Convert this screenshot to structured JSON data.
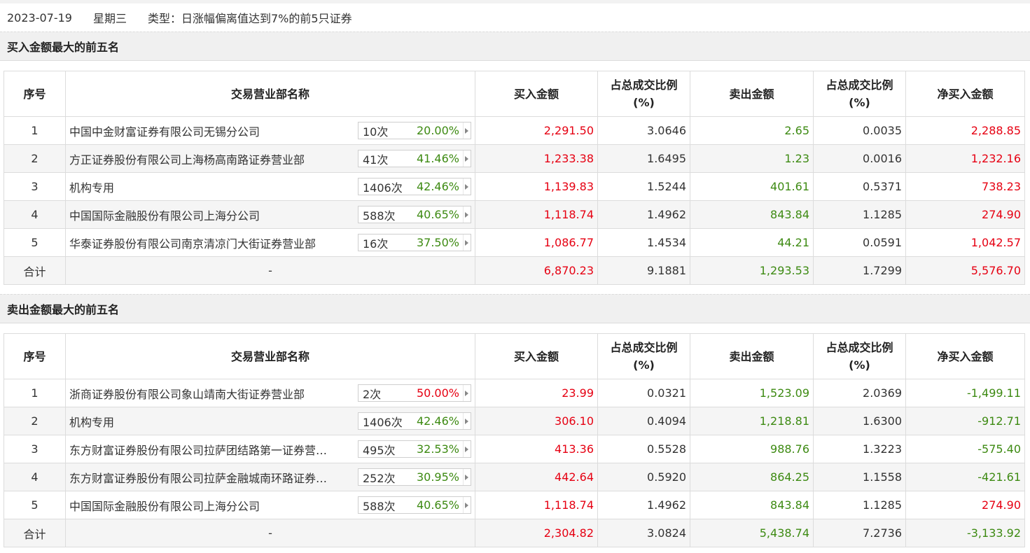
{
  "header": {
    "date": "2023-07-19",
    "weekday": "星期三",
    "type": "类型：日涨幅偏离值达到7%的前5只证券"
  },
  "columns": {
    "idx": "序号",
    "name": "交易营业部名称",
    "buy": "买入金额",
    "buy_pct_l1": "占总成交比例",
    "buy_pct_l2": "(%)",
    "sell": "卖出金额",
    "sell_pct_l1": "占总成交比例",
    "sell_pct_l2": "(%)",
    "net": "净买入金额"
  },
  "buy_section": {
    "title": "买入金额最大的前五名",
    "rows": [
      {
        "idx": "1",
        "name": "中国中金财富证券有限公司无锡分公司",
        "count": "10次",
        "rate": "20.00%",
        "rate_color": "green",
        "buy": "2,291.50",
        "buy_pct": "3.0646",
        "sell": "2.65",
        "sell_pct": "0.0035",
        "net": "2,288.85",
        "net_color": "red"
      },
      {
        "idx": "2",
        "name": "方正证券股份有限公司上海杨高南路证券营业部",
        "count": "41次",
        "rate": "41.46%",
        "rate_color": "green",
        "buy": "1,233.38",
        "buy_pct": "1.6495",
        "sell": "1.23",
        "sell_pct": "0.0016",
        "net": "1,232.16",
        "net_color": "red"
      },
      {
        "idx": "3",
        "name": "机构专用",
        "count": "1406次",
        "rate": "42.46%",
        "rate_color": "green",
        "buy": "1,139.83",
        "buy_pct": "1.5244",
        "sell": "401.61",
        "sell_pct": "0.5371",
        "net": "738.23",
        "net_color": "red"
      },
      {
        "idx": "4",
        "name": "中国国际金融股份有限公司上海分公司",
        "count": "588次",
        "rate": "40.65%",
        "rate_color": "green",
        "buy": "1,118.74",
        "buy_pct": "1.4962",
        "sell": "843.84",
        "sell_pct": "1.1285",
        "net": "274.90",
        "net_color": "red"
      },
      {
        "idx": "5",
        "name": "华泰证券股份有限公司南京清凉门大街证券营业部",
        "count": "16次",
        "rate": "37.50%",
        "rate_color": "green",
        "buy": "1,086.77",
        "buy_pct": "1.4534",
        "sell": "44.21",
        "sell_pct": "0.0591",
        "net": "1,042.57",
        "net_color": "red"
      }
    ],
    "total": {
      "label": "合计",
      "name": "-",
      "buy": "6,870.23",
      "buy_pct": "9.1881",
      "sell": "1,293.53",
      "sell_pct": "1.7299",
      "net": "5,576.70",
      "net_color": "red"
    }
  },
  "sell_section": {
    "title": "卖出金额最大的前五名",
    "rows": [
      {
        "idx": "1",
        "name": "浙商证券股份有限公司象山靖南大街证券营业部",
        "count": "2次",
        "rate": "50.00%",
        "rate_color": "red",
        "buy": "23.99",
        "buy_pct": "0.0321",
        "sell": "1,523.09",
        "sell_pct": "2.0369",
        "net": "-1,499.11",
        "net_color": "green"
      },
      {
        "idx": "2",
        "name": "机构专用",
        "count": "1406次",
        "rate": "42.46%",
        "rate_color": "green",
        "buy": "306.10",
        "buy_pct": "0.4094",
        "sell": "1,218.81",
        "sell_pct": "1.6300",
        "net": "-912.71",
        "net_color": "green"
      },
      {
        "idx": "3",
        "name": "东方财富证券股份有限公司拉萨团结路第一证券营…",
        "count": "495次",
        "rate": "32.53%",
        "rate_color": "green",
        "buy": "413.36",
        "buy_pct": "0.5528",
        "sell": "988.76",
        "sell_pct": "1.3223",
        "net": "-575.40",
        "net_color": "green"
      },
      {
        "idx": "4",
        "name": "东方财富证券股份有限公司拉萨金融城南环路证券…",
        "count": "252次",
        "rate": "30.95%",
        "rate_color": "green",
        "buy": "442.64",
        "buy_pct": "0.5920",
        "sell": "864.25",
        "sell_pct": "1.1558",
        "net": "-421.61",
        "net_color": "green"
      },
      {
        "idx": "5",
        "name": "中国国际金融股份有限公司上海分公司",
        "count": "588次",
        "rate": "40.65%",
        "rate_color": "green",
        "buy": "1,118.74",
        "buy_pct": "1.4962",
        "sell": "843.84",
        "sell_pct": "1.1285",
        "net": "274.90",
        "net_color": "red"
      }
    ],
    "total": {
      "label": "合计",
      "name": "-",
      "buy": "2,304.82",
      "buy_pct": "3.0824",
      "sell": "5,438.74",
      "sell_pct": "7.2736",
      "net": "-3,133.92",
      "net_color": "green"
    }
  }
}
